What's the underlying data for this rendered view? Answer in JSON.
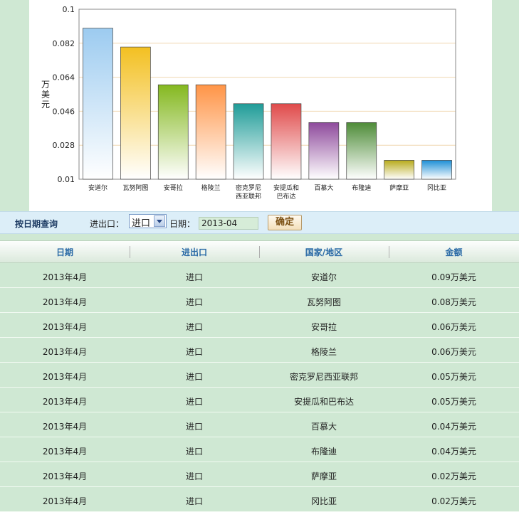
{
  "chart_data": {
    "type": "bar",
    "ylabel": "万美元",
    "ylim": [
      0.01,
      0.1
    ],
    "yticks": [
      "0.1",
      "0.082",
      "0.064",
      "0.046",
      "0.028",
      "0.01"
    ],
    "categories": [
      "安道尔",
      "瓦努阿图",
      "安哥拉",
      "格陵兰",
      "密克罗尼西亚联邦",
      "安提瓜和巴布达",
      "百慕大",
      "布隆迪",
      "萨摩亚",
      "冈比亚"
    ],
    "category_lines": [
      [
        "安道尔"
      ],
      [
        "瓦努阿图"
      ],
      [
        "安哥拉"
      ],
      [
        "格陵兰"
      ],
      [
        "密克罗尼",
        "西亚联邦"
      ],
      [
        "安提瓜和",
        "巴布达"
      ],
      [
        "百慕大"
      ],
      [
        "布隆迪"
      ],
      [
        "萨摩亚"
      ],
      [
        "冈比亚"
      ]
    ],
    "values": [
      0.09,
      0.08,
      0.06,
      0.06,
      0.05,
      0.05,
      0.04,
      0.04,
      0.02,
      0.02
    ],
    "bar_colors": [
      "#9ccbf0",
      "#f3c021",
      "#84b81f",
      "#ff9446",
      "#1f9c98",
      "#e04a4a",
      "#8e4a9c",
      "#4e8c38",
      "#b8ab1c",
      "#1d8fd6"
    ],
    "gridline_color": "#f0d7b0",
    "grid": true
  },
  "filter": {
    "title": "按日期查询",
    "io_label": "进出口：",
    "io_value": "进口",
    "date_label": "日期：",
    "date_value": "2013-04",
    "confirm": "确定"
  },
  "table": {
    "headers": [
      "日期",
      "进出口",
      "国家/地区",
      "金额"
    ],
    "rows": [
      [
        "2013年4月",
        "进口",
        "安道尔",
        "0.09万美元"
      ],
      [
        "2013年4月",
        "进口",
        "瓦努阿图",
        "0.08万美元"
      ],
      [
        "2013年4月",
        "进口",
        "安哥拉",
        "0.06万美元"
      ],
      [
        "2013年4月",
        "进口",
        "格陵兰",
        "0.06万美元"
      ],
      [
        "2013年4月",
        "进口",
        "密克罗尼西亚联邦",
        "0.05万美元"
      ],
      [
        "2013年4月",
        "进口",
        "安提瓜和巴布达",
        "0.05万美元"
      ],
      [
        "2013年4月",
        "进口",
        "百慕大",
        "0.04万美元"
      ],
      [
        "2013年4月",
        "进口",
        "布隆迪",
        "0.04万美元"
      ],
      [
        "2013年4月",
        "进口",
        "萨摩亚",
        "0.02万美元"
      ],
      [
        "2013年4月",
        "进口",
        "冈比亚",
        "0.02万美元"
      ]
    ]
  }
}
